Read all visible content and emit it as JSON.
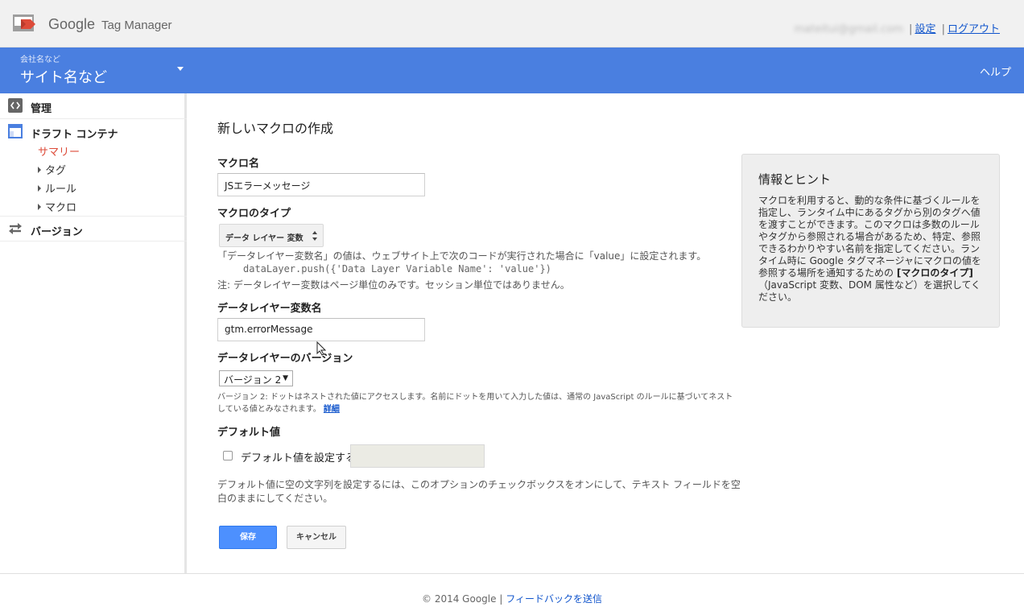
{
  "header": {
    "brand": "Google",
    "product": "Tag Manager",
    "user_email": "mateitui@gmail.com",
    "settings_link": "設定",
    "logout_link": "ログアウト",
    "separator": "|"
  },
  "account_bar": {
    "company": "会社名など",
    "site": "サイト名など",
    "help": "ヘルプ"
  },
  "sidebar": {
    "admin": "管理",
    "draft": "ドラフト コンテナ",
    "summary": "サマリー",
    "tags": "タグ",
    "rules": "ルール",
    "macros": "マクロ",
    "versions": "バージョン"
  },
  "form": {
    "title": "新しいマクロの作成",
    "macro_name_label": "マクロ名",
    "macro_name_value": "JSエラーメッセージ",
    "macro_type_label": "マクロのタイプ",
    "macro_type_value": "データ レイヤー 変数",
    "type_desc": "「データレイヤー変数名」の値は、ウェブサイト上で次のコードが実行された場合に「value」に設定されます。",
    "type_code": "dataLayer.push({'Data Layer Variable Name': 'value'})",
    "type_note": "注: データレイヤー変数はページ単位のみです。セッション単位ではありません。",
    "dl_var_label": "データレイヤー変数名",
    "dl_var_value": "gtm.errorMessage",
    "dl_version_label": "データレイヤーのバージョン",
    "dl_version_value": "バージョン 2",
    "version_desc": "バージョン 2: ドットはネストされた値にアクセスします。名前にドットを用いて入力した値は、通常の JavaScript のルールに基づいてネストしている値とみなされます。",
    "details_link": "詳細",
    "default_label": "デフォルト値",
    "default_checkbox_label": "デフォルト値を設定する:",
    "default_note": "デフォルト値に空の文字列を設定するには、このオプションのチェックボックスをオンにして、テキスト フィールドを空白のままにしてください。",
    "save": "保存",
    "cancel": "キャンセル"
  },
  "info": {
    "title": "情報とヒント",
    "body_1": "マクロを利用すると、動的な条件に基づくルールを指定し、ランタイム中にあるタグから別のタグへ値を渡すことができます。このマクロは多数のルールやタグから参照される場合があるため、特定、参照できるわかりやすい名前を指定してください。ランタイム時に Google タグマネージャにマクロの値を参照する場所を通知するための",
    "body_bold": "[マクロのタイプ]",
    "body_2": "（JavaScript 変数、DOM 属性など）を選択してください。"
  },
  "footer": {
    "copyright": "© 2014 Google",
    "separator": "|",
    "feedback": "フィードバックを送信"
  },
  "colors": {
    "blue_bar": "#4a7fe0",
    "link": "#1155cc",
    "active_nav": "#dd4b39",
    "save_button": "#4d90fe"
  }
}
